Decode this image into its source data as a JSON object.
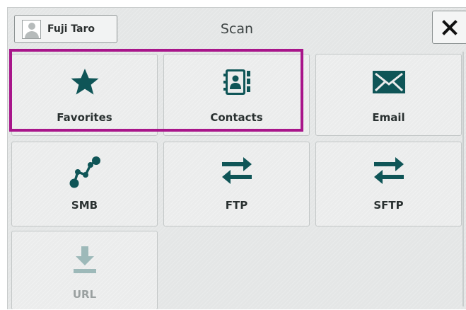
{
  "header": {
    "user_name": "Fuji Taro",
    "title": "Scan"
  },
  "tiles": [
    {
      "label": "Favorites",
      "icon": "star-icon",
      "enabled": true
    },
    {
      "label": "Contacts",
      "icon": "address-book-icon",
      "enabled": true
    },
    {
      "label": "Email",
      "icon": "envelope-icon",
      "enabled": true
    },
    {
      "label": "SMB",
      "icon": "network-nodes-icon",
      "enabled": true
    },
    {
      "label": "FTP",
      "icon": "transfer-arrows-icon",
      "enabled": true
    },
    {
      "label": "SFTP",
      "icon": "transfer-arrows-icon",
      "enabled": true
    },
    {
      "label": "URL",
      "icon": "download-icon",
      "enabled": false
    }
  ],
  "colors": {
    "icon": "#0f5557",
    "icon_disabled": "#9db9b9",
    "highlight": "#a8158a"
  }
}
